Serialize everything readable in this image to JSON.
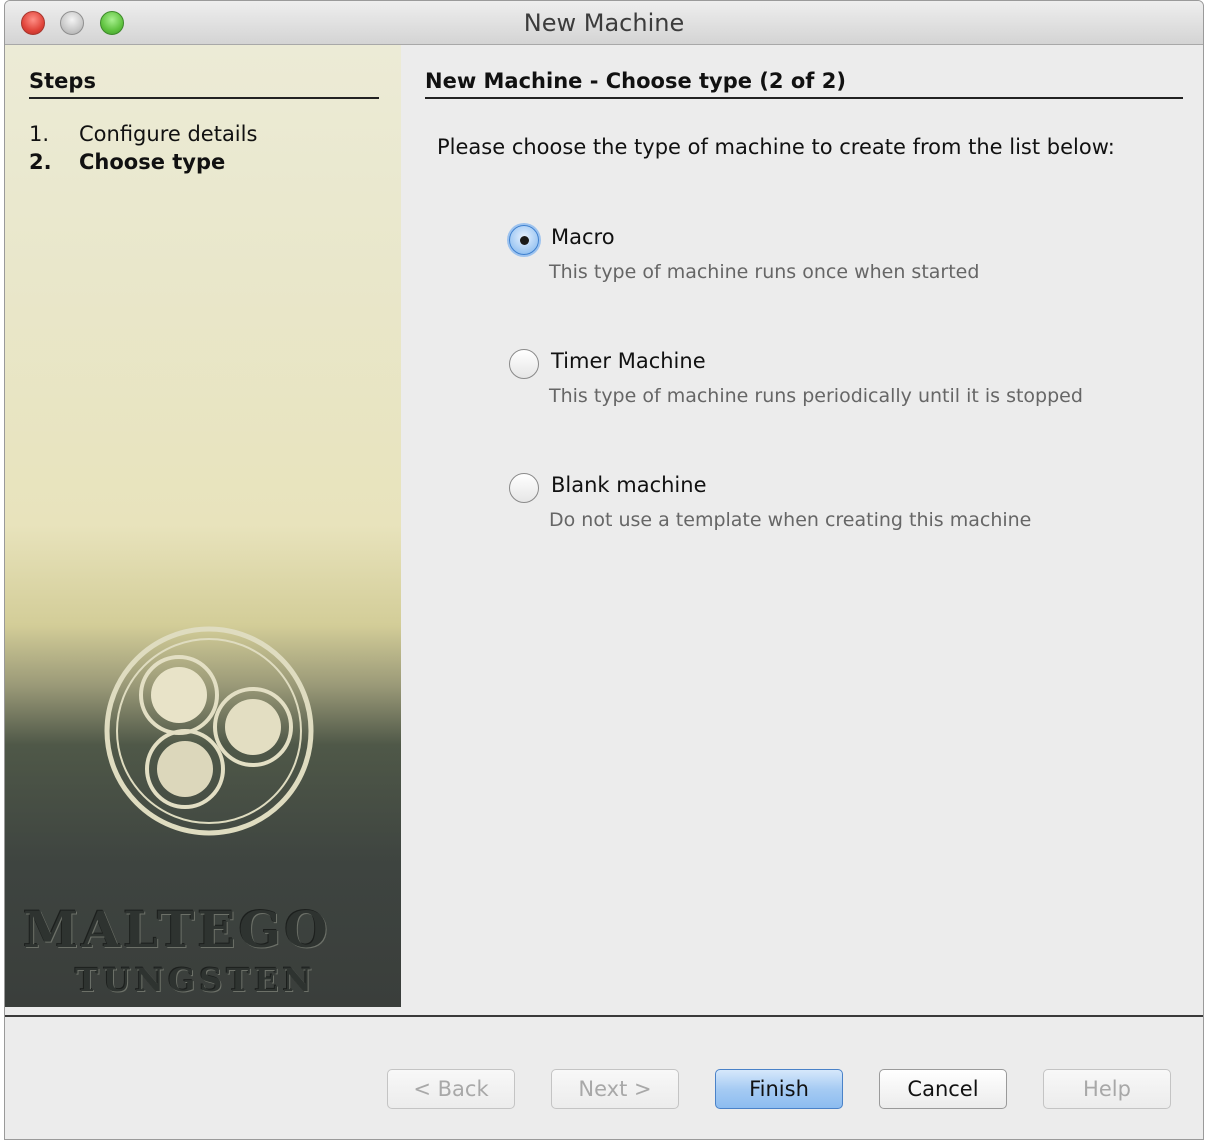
{
  "window": {
    "title": "New Machine"
  },
  "sidebar": {
    "title": "Steps",
    "steps": [
      {
        "num": "1.",
        "label": "Configure details"
      },
      {
        "num": "2.",
        "label": "Choose type"
      }
    ],
    "logo": {
      "text": "MALTEGO",
      "subtext": "TUNGSTEN"
    }
  },
  "main": {
    "title": "New Machine - Choose type (2 of 2)",
    "instruction": "Please choose the type of machine to create from the list below:",
    "options": [
      {
        "label": "Macro",
        "description": "This type of machine runs once when started",
        "selected": true
      },
      {
        "label": "Timer Machine",
        "description": "This type of machine runs periodically until it is stopped",
        "selected": false
      },
      {
        "label": "Blank machine",
        "description": "Do not use a template when creating this machine",
        "selected": false
      }
    ]
  },
  "buttons": {
    "back": "< Back",
    "next": "Next >",
    "finish": "Finish",
    "cancel": "Cancel",
    "help": "Help"
  }
}
